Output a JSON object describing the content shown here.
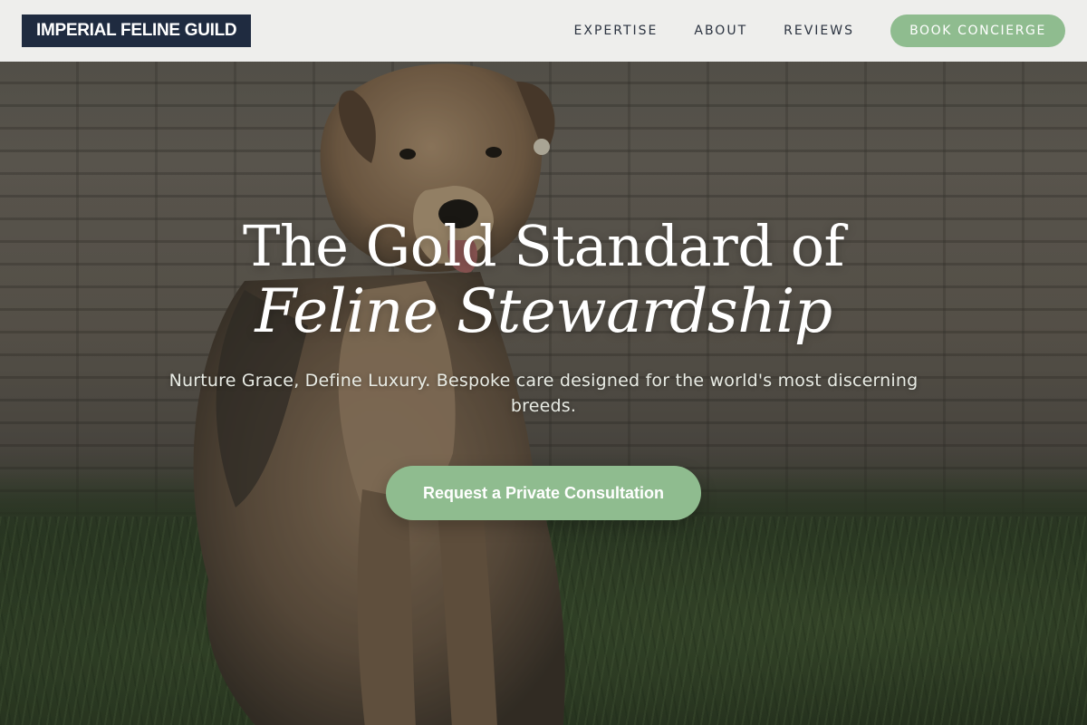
{
  "header": {
    "brand": "IMPERIAL FELINE GUILD",
    "nav": [
      {
        "label": "EXPERTISE"
      },
      {
        "label": "ABOUT"
      },
      {
        "label": "REVIEWS"
      }
    ],
    "cta_label": "BOOK CONCIERGE"
  },
  "hero": {
    "title_line1": "The Gold Standard of",
    "title_line2": "Feline Stewardship",
    "subtitle": "Nurture Grace, Define Luxury. Bespoke care designed for the world's most discerning breeds.",
    "cta_label": "Request a Private Consultation"
  },
  "colors": {
    "brand_bg": "#1f2b40",
    "accent_green": "#8fbc8f",
    "header_bg": "#f4f4f2"
  }
}
